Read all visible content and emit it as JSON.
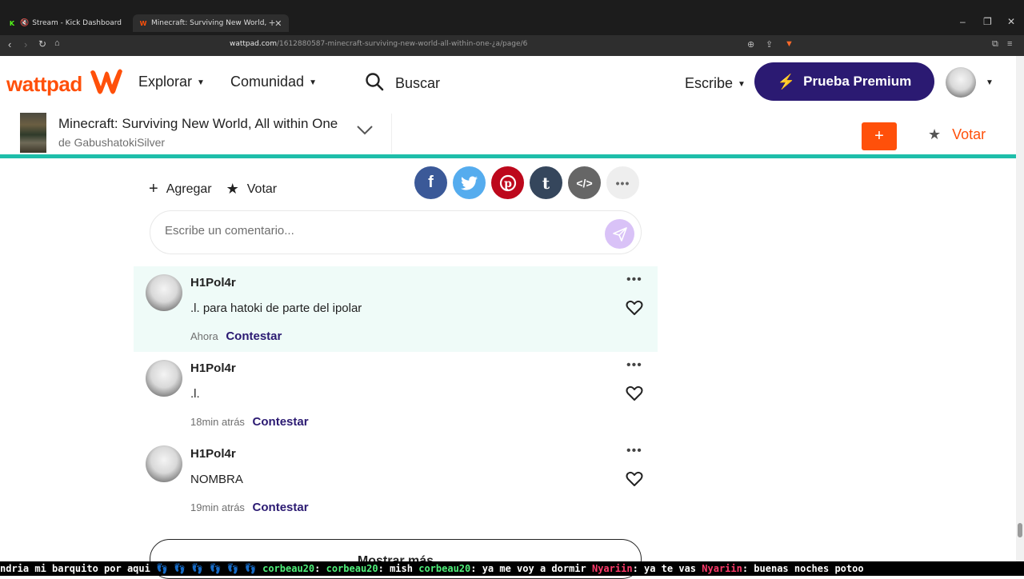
{
  "browser": {
    "tabs": [
      {
        "label": "Stream - Kick Dashboard",
        "active": false
      },
      {
        "label": "Minecraft: Surviving New World,",
        "active": true
      }
    ],
    "url_host": "wattpad.com",
    "url_path": "/1612880587-minecraft-surviving-new-world-all-within-one-¿a/page/6"
  },
  "header": {
    "logo": "wattpad",
    "explore": "Explorar",
    "community": "Comunidad",
    "search": "Buscar",
    "write": "Escribe",
    "premium": "Prueba Premium"
  },
  "story": {
    "title": "Minecraft: Surviving New World, All within One",
    "author": "de GabushatokiSilver",
    "add": "+",
    "vote": "Votar"
  },
  "actions": {
    "add": "Agregar",
    "vote": "Votar"
  },
  "share_icons": [
    "facebook-icon",
    "twitter-icon",
    "pinterest-icon",
    "tumblr-icon",
    "embed-icon",
    "more-icon"
  ],
  "comment_input": {
    "placeholder": "Escribe un comentario..."
  },
  "comments": [
    {
      "user": "H1Pol4r",
      "text": ".l. para hatoki de parte del ipolar",
      "time": "Ahora",
      "reply": "Contestar"
    },
    {
      "user": "H1Pol4r",
      "text": ".l.",
      "time": "18min atrás",
      "reply": "Contestar"
    },
    {
      "user": "H1Pol4r",
      "text": "NOMBRA",
      "time": "19min atrás",
      "reply": "Contestar"
    }
  ],
  "show_more": "Mostrar más",
  "ticker": {
    "t1": "ndria mi barquito por aqui",
    "u1": "corbeau20",
    "m1": ":",
    "u2": "corbeau20",
    "m2": ": mish",
    "u3": "corbeau20",
    "m3": ": ya me voy a dormir",
    "u4": "Nyariin",
    "m4": ": ya te vas",
    "u5": "Nyariin",
    "m5": ": buenas noches potoo"
  },
  "colors": {
    "brand": "#ff500a",
    "premium": "#2b1a72",
    "teal": "#1ebeaa"
  }
}
